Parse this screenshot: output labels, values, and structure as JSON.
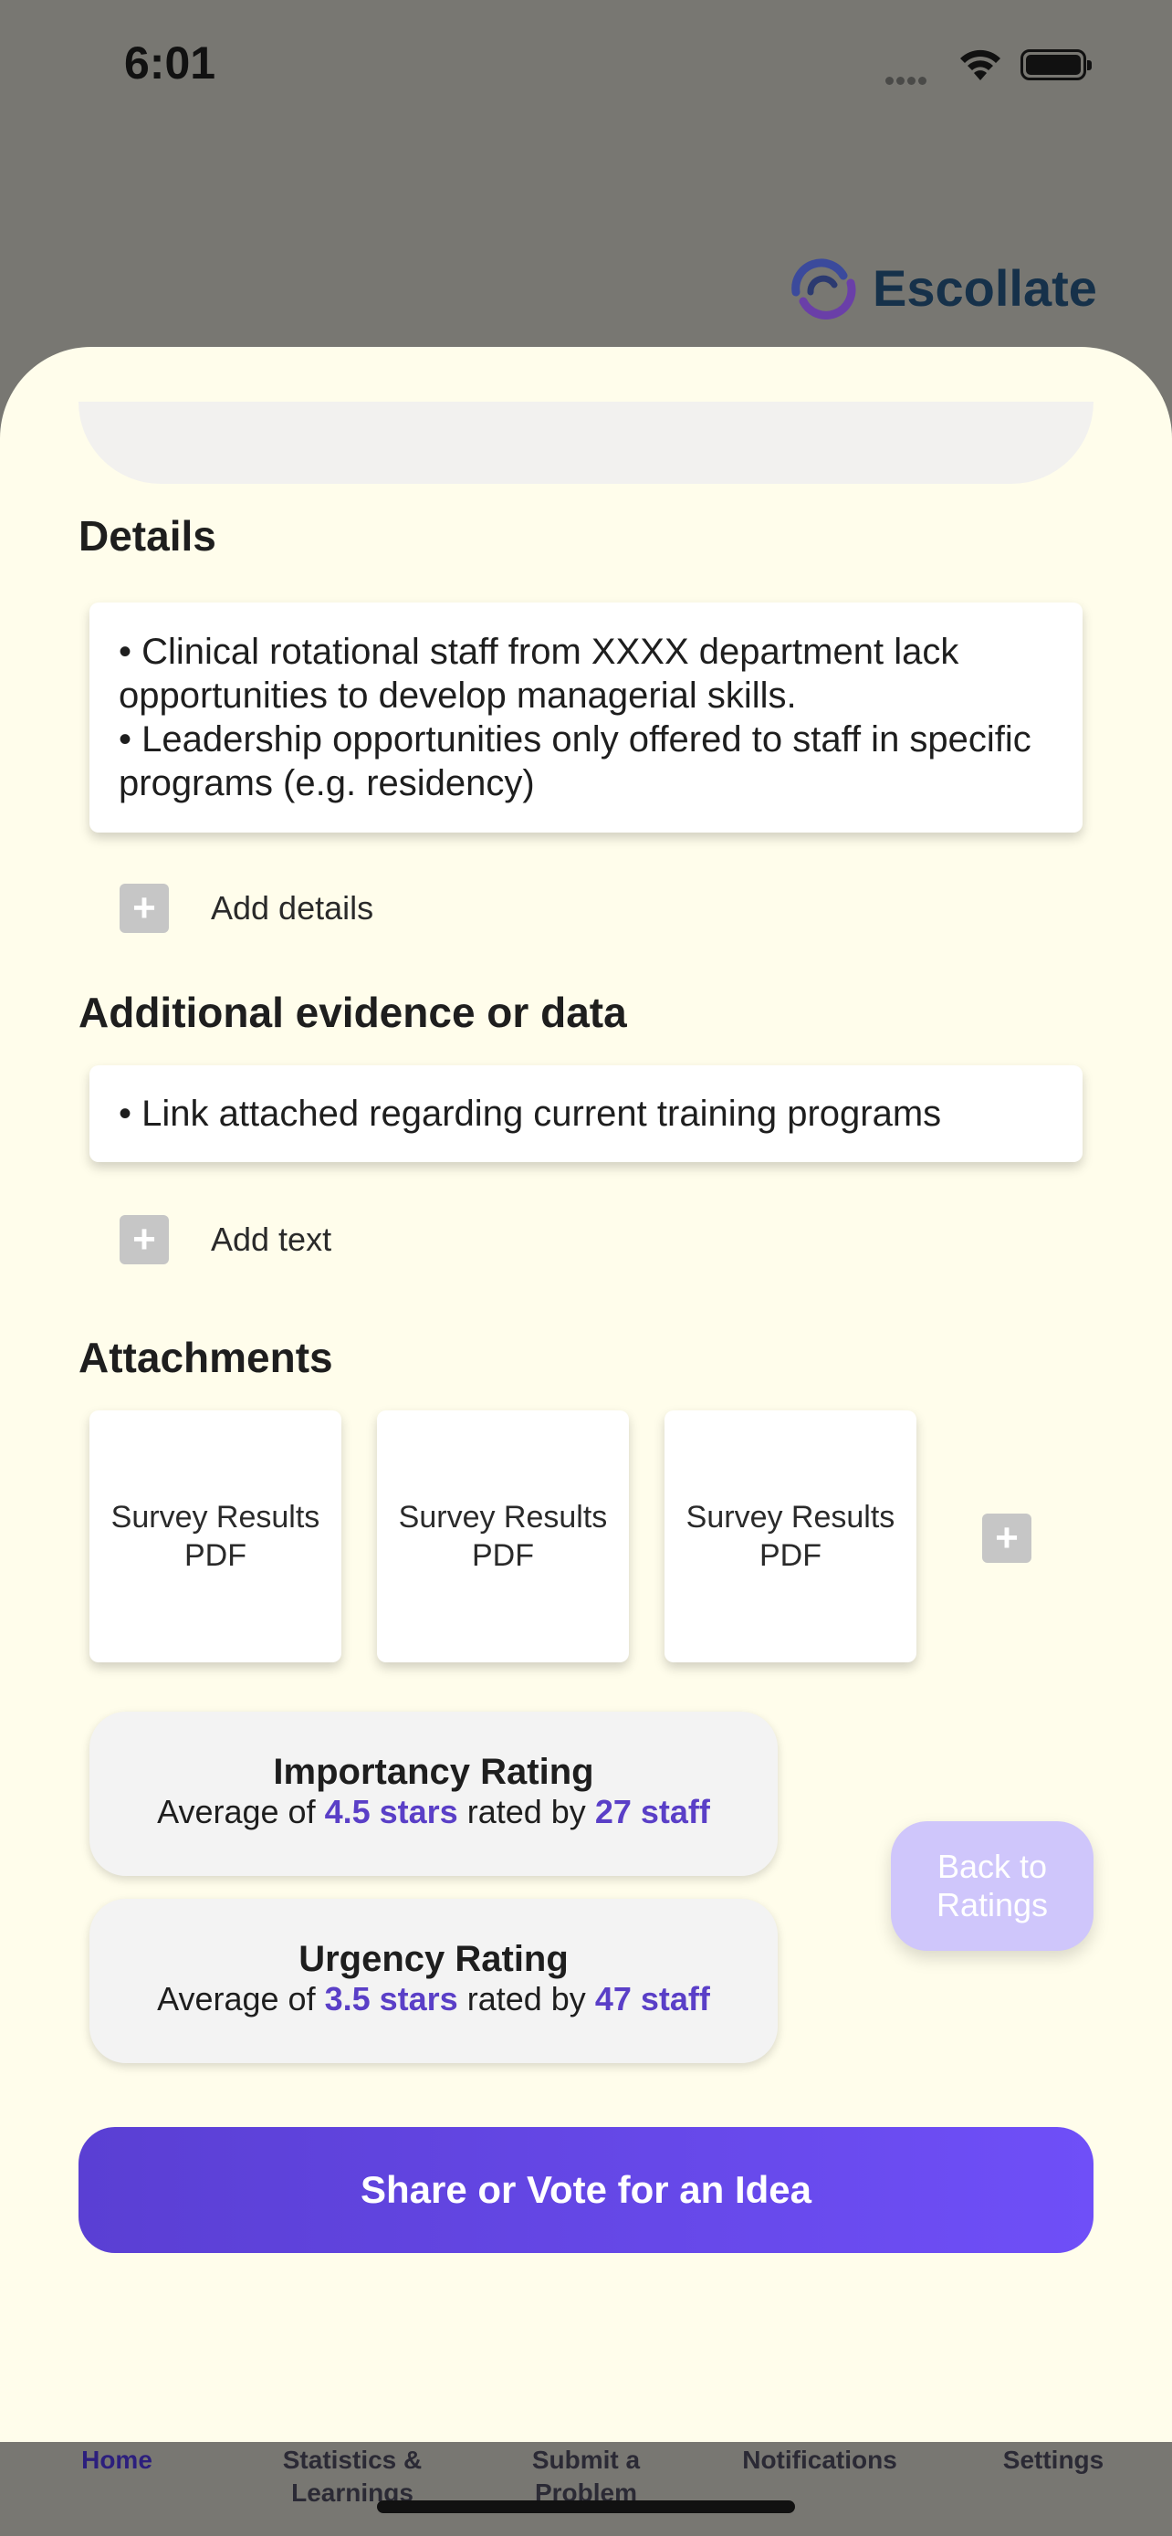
{
  "status_bar": {
    "time": "6:01"
  },
  "brand": {
    "name": "Escollate"
  },
  "details": {
    "heading": "Details",
    "lines": [
      "• Clinical rotational staff from XXXX department lack opportunities to develop managerial skills.",
      "• Leadership opportunities only offered to staff in specific programs (e.g. residency)"
    ],
    "add_label": "Add details"
  },
  "evidence": {
    "heading": "Additional evidence or data",
    "lines": [
      "• Link attached regarding current training programs"
    ],
    "add_label": "Add text"
  },
  "attachments": {
    "heading": "Attachments",
    "items": [
      {
        "label": "Survey Results PDF"
      },
      {
        "label": "Survey Results PDF"
      },
      {
        "label": "Survey Results PDF"
      }
    ]
  },
  "ratings": [
    {
      "title": "Importancy Rating",
      "prefix": "Average of",
      "stars": "4.5 stars",
      "middle": "rated by",
      "staff": "27 staff"
    },
    {
      "title": "Urgency Rating",
      "prefix": "Average of",
      "stars": "3.5 stars",
      "middle": "rated by",
      "staff": "47 staff"
    }
  ],
  "back_button": "Back to Ratings",
  "share_button": "Share or Vote for an Idea",
  "tabs": [
    {
      "label": "Home"
    },
    {
      "label": "Statistics & Learnings"
    },
    {
      "label": "Submit a Problem"
    },
    {
      "label": "Notifications"
    },
    {
      "label": "Settings"
    }
  ],
  "colors": {
    "accent": "#5a3fc7",
    "sheet_bg": "#fffdeb",
    "overlay": "#787772",
    "brand": "#16314a"
  }
}
